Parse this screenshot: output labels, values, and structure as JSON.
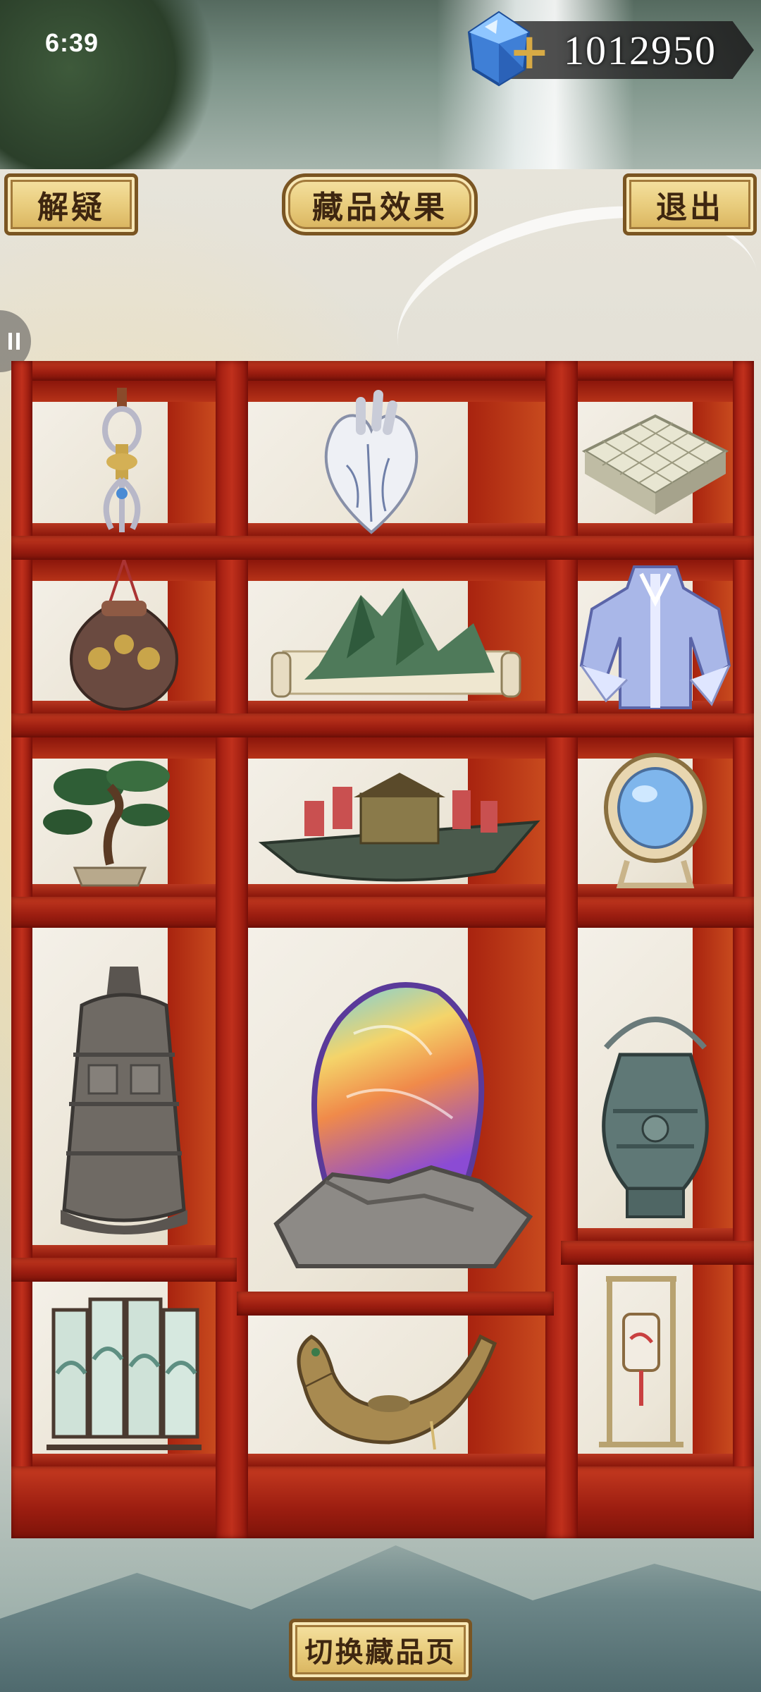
{
  "status_bar": {
    "time": "6:39"
  },
  "currency": {
    "value": "1012950",
    "icon": "blue-gem-icon",
    "add_icon": "plus-icon"
  },
  "header": {
    "left_button": "解疑",
    "center_button": "藏品效果",
    "right_button": "退出"
  },
  "collection": {
    "items": [
      {
        "name": "vajra-relic",
        "icon": "vajra-icon"
      },
      {
        "name": "porcelain-heart",
        "icon": "heart-icon"
      },
      {
        "name": "stone-go-board",
        "icon": "go-board-icon"
      },
      {
        "name": "gold-ornament-pouch",
        "icon": "pouch-icon"
      },
      {
        "name": "landscape-scroll",
        "icon": "scroll-icon"
      },
      {
        "name": "blue-robe",
        "icon": "robe-icon"
      },
      {
        "name": "bonsai-pine",
        "icon": "bonsai-icon"
      },
      {
        "name": "dragon-warship",
        "icon": "ship-icon"
      },
      {
        "name": "ornate-mirror",
        "icon": "mirror-icon"
      },
      {
        "name": "bronze-bell",
        "icon": "bell-icon"
      },
      {
        "name": "rainbow-crystal-stone",
        "icon": "crystal-icon"
      },
      {
        "name": "bronze-ritual-vessel",
        "icon": "vessel-icon"
      },
      {
        "name": "folding-screen",
        "icon": "screen-icon"
      },
      {
        "name": "dragon-boat-vessel",
        "icon": "boat-icon"
      },
      {
        "name": "hanging-lantern",
        "icon": "lantern-icon"
      }
    ]
  },
  "footer": {
    "switch_button": "切换藏品页"
  },
  "colors": {
    "cabinet_red": "#b02a15",
    "plaque_gold": "#e9cd7e",
    "plaque_border": "#7a5522"
  }
}
